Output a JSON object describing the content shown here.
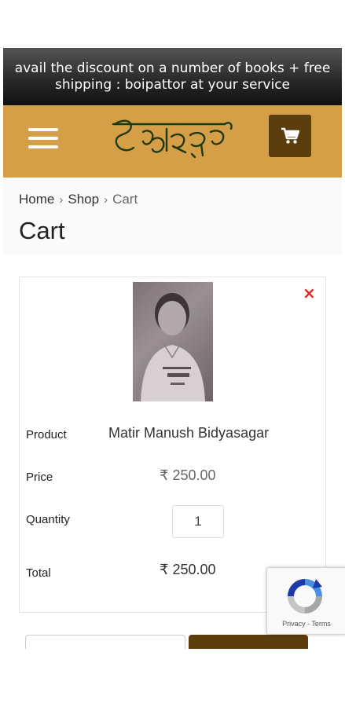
{
  "promo": {
    "text": "avail the discount on a number of books + free shipping : boipattor at your service"
  },
  "header": {
    "menu_icon": "hamburger-icon",
    "logo_text": "বইপত্তর",
    "cart_icon": "cart-icon",
    "brand_color": "#d59f48",
    "dark_color": "#5c3d0e"
  },
  "breadcrumb": {
    "items": [
      "Home",
      "Shop",
      "Cart"
    ],
    "separator": "›"
  },
  "page_title": "Cart",
  "cart_item": {
    "remove_icon": "×",
    "product_label": "Product",
    "product_name": "Matir Manush Bidyasagar",
    "price_label": "Price",
    "price": "₹ 250.00",
    "quantity_label": "Quantity",
    "quantity": "1",
    "total_label": "Total",
    "total": "₹ 250.00"
  },
  "recaptcha": {
    "terms": "Privacy - Terms"
  }
}
